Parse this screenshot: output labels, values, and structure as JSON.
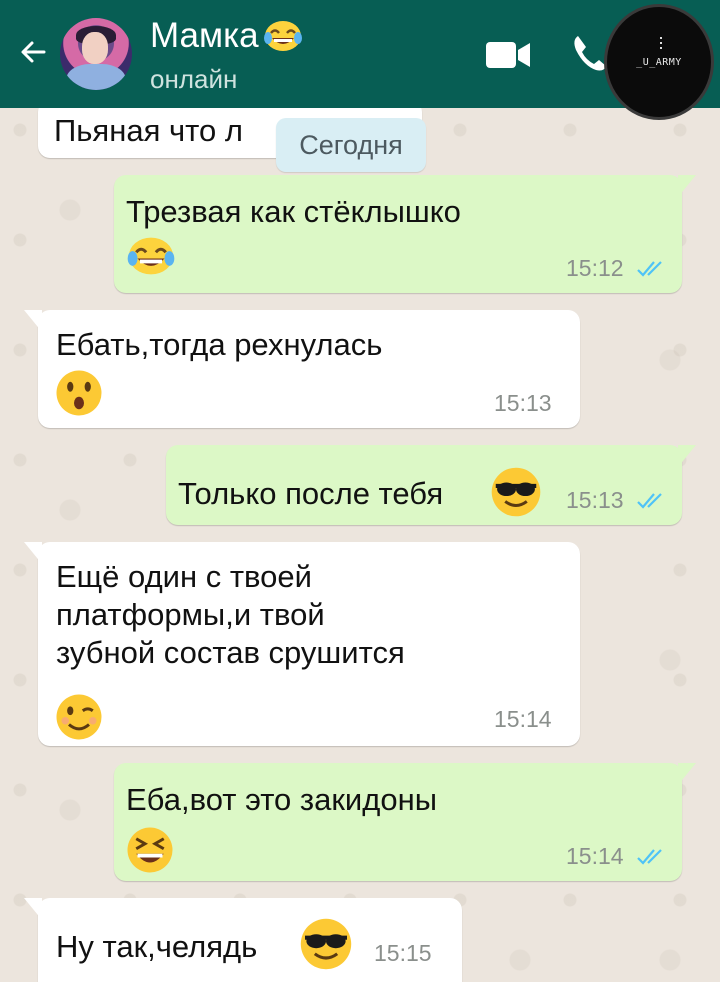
{
  "header": {
    "contact_name": "Мамка",
    "status": "онлайн",
    "watermark": "_U_ARMY"
  },
  "date_chip": "Сегодня",
  "messages": [
    {
      "direction": "in",
      "text": "Пьяная что л",
      "time": "",
      "emoji": "",
      "note": "partially hidden by header"
    },
    {
      "direction": "out",
      "text": "Трезвая как стёклышко",
      "time": "15:12",
      "emoji": "tears-of-joy",
      "read": true
    },
    {
      "direction": "in",
      "text": "Ебать,тогда рехнулась",
      "time": "15:13",
      "emoji": "astonished"
    },
    {
      "direction": "out",
      "text": "Только после тебя",
      "time": "15:13",
      "emoji": "sunglasses",
      "read": true
    },
    {
      "direction": "in",
      "text": "Ещё один с твоей\nплатформы,и твой\nзубной состав срушится",
      "time": "15:14",
      "emoji": "wink"
    },
    {
      "direction": "out",
      "text": "Еба,вот это закидоны",
      "time": "15:14",
      "emoji": "grinning-squint",
      "read": true
    },
    {
      "direction": "in",
      "text": "Ну так,челядь",
      "time": "15:15",
      "emoji": "sunglasses"
    }
  ],
  "colors": {
    "header": "#075e54",
    "outgoing_bubble": "#dcf8c6",
    "incoming_bubble": "#ffffff",
    "read_ticks": "#4fc3f7",
    "chat_background": "#ece5dd"
  }
}
